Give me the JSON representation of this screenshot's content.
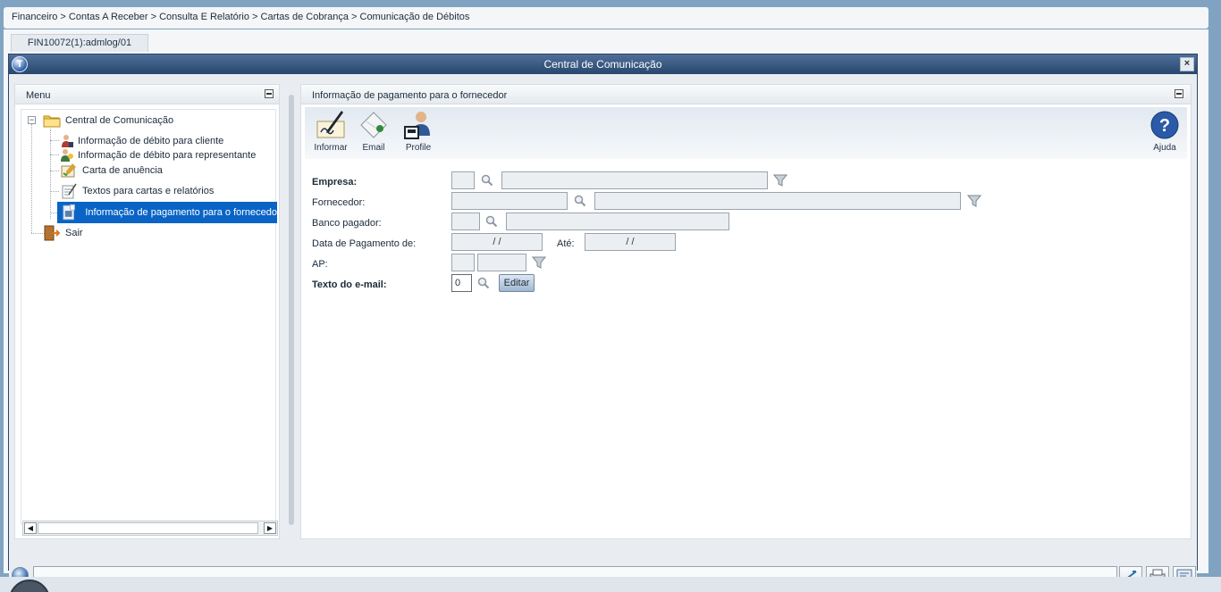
{
  "breadcrumb": "Financeiro > Contas A Receber > Consulta E Relatório > Cartas de Cobrança > Comunicação de Débitos",
  "document_tab": "FIN10072(1):admlog/01",
  "window": {
    "title": "Central de Comunicação",
    "close_label": "×",
    "app_icon_label": "T"
  },
  "menu_panel": {
    "title": "Menu",
    "tree": {
      "root": {
        "label": "Central de Comunicação",
        "icon": "folder-icon",
        "expander": "−"
      },
      "items": [
        {
          "label": "Informação de débito para cliente",
          "icon": "client-icon"
        },
        {
          "label": "Informação de débito para representante",
          "icon": "representative-icon"
        },
        {
          "label": "Carta de anuência",
          "icon": "letter-icon"
        },
        {
          "label": "Textos para cartas e relatórios",
          "icon": "text-edit-icon"
        },
        {
          "label": "Informação de pagamento para o fornecedo",
          "icon": "supplier-doc-icon",
          "selected": true
        }
      ],
      "exit": {
        "label": "Sair",
        "icon": "exit-icon"
      }
    },
    "scroll_left": "◀",
    "scroll_right": "▶"
  },
  "content_panel": {
    "title": "Informação de pagamento para o fornecedor",
    "toolbar": {
      "inform": {
        "label": "Informar",
        "icon": "pen-sign-icon"
      },
      "email": {
        "label": "Email",
        "icon": "email-icon"
      },
      "profile": {
        "label": "Profile",
        "icon": "profile-icon"
      },
      "help": {
        "label": "Ajuda",
        "icon": "help-icon"
      }
    },
    "form": {
      "empresa": {
        "label": "Empresa:",
        "code": "",
        "name": ""
      },
      "fornecedor": {
        "label": "Fornecedor:",
        "code": "",
        "name": ""
      },
      "banco": {
        "label": "Banco pagador:",
        "code": "",
        "name": ""
      },
      "data_pagamento": {
        "label": "Data de Pagamento de:",
        "from": "/ /",
        "to_label": "Até:",
        "to": "/ /"
      },
      "ap": {
        "label": "AP:",
        "code1": "",
        "code2": ""
      },
      "texto_email": {
        "label": "Texto do e-mail:",
        "value": "0",
        "button": "Editar"
      }
    }
  },
  "colors": {
    "titlebar": "#28476e",
    "selection": "#0a64c6",
    "background": "#7fa3c1"
  }
}
